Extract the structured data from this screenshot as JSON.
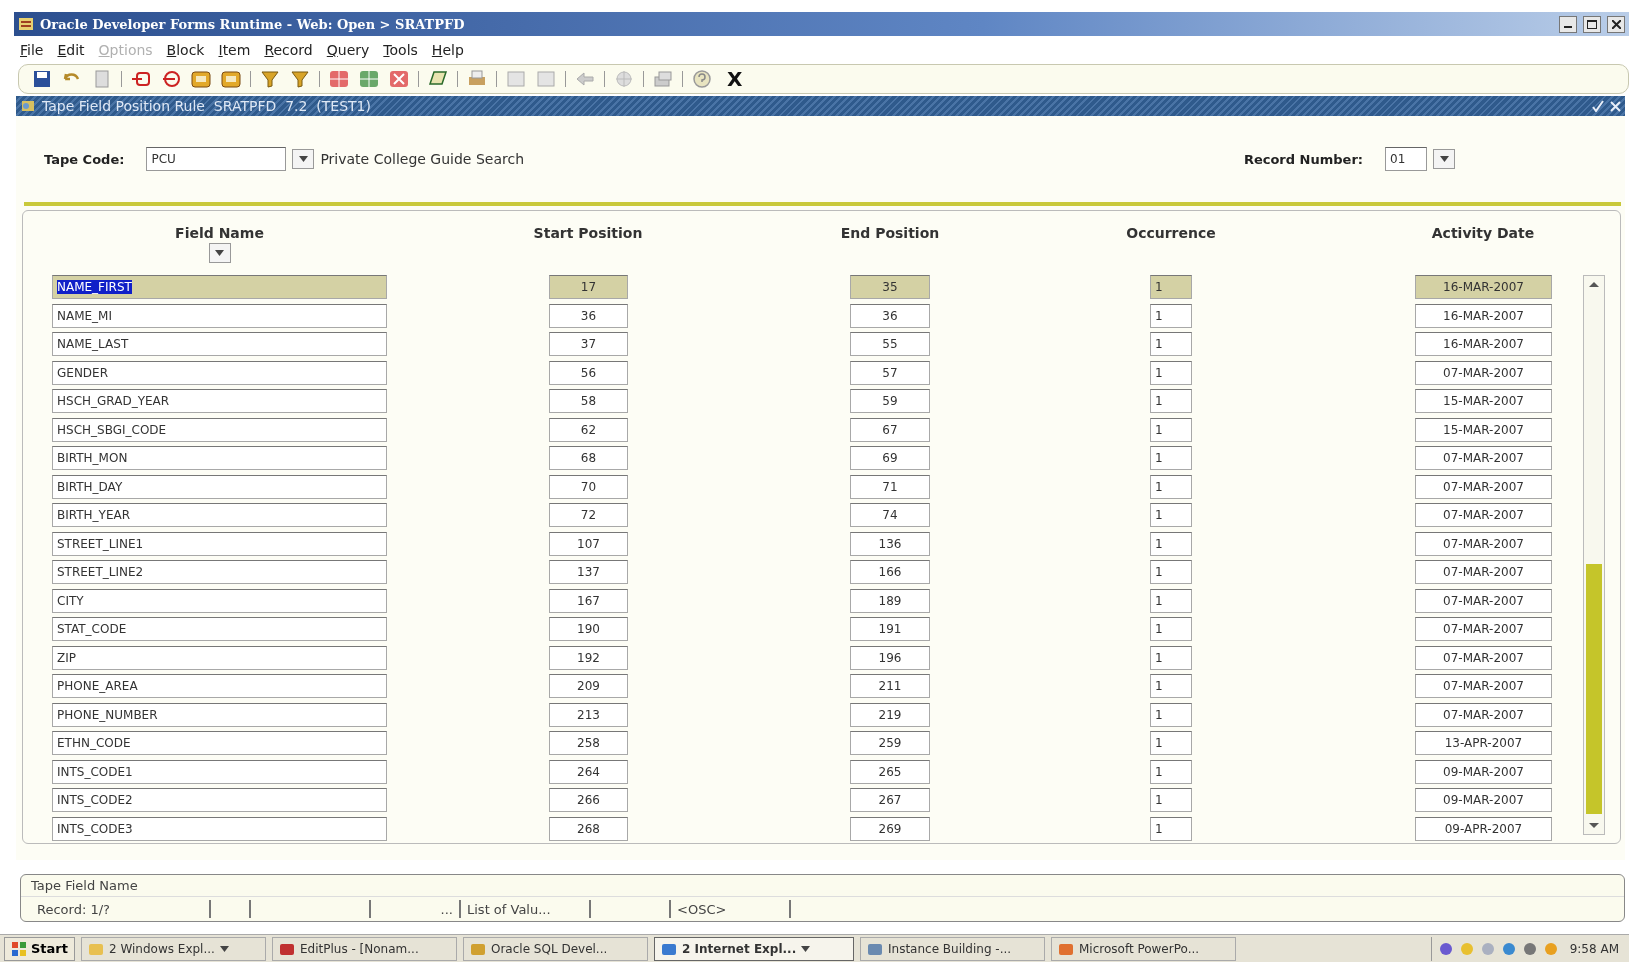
{
  "window": {
    "title": "Oracle Developer Forms Runtime - Web: Open > SRATPFD"
  },
  "menu": [
    {
      "label": "File",
      "disabled": false
    },
    {
      "label": "Edit",
      "disabled": false
    },
    {
      "label": "Options",
      "disabled": true
    },
    {
      "label": "Block",
      "disabled": false
    },
    {
      "label": "Item",
      "disabled": false
    },
    {
      "label": "Record",
      "disabled": false
    },
    {
      "label": "Query",
      "disabled": false
    },
    {
      "label": "Tools",
      "disabled": false
    },
    {
      "label": "Help",
      "disabled": false
    }
  ],
  "toolbar": {
    "exit": "X"
  },
  "form": {
    "title": "Tape Field Position Rule  SRATPFD  7.2  (TEST1)",
    "tape_code": {
      "label": "Tape Code:",
      "value": "PCU",
      "description": "Private College Guide Search"
    },
    "record_number": {
      "label": "Record Number:",
      "value": "01"
    }
  },
  "table": {
    "columns": [
      "Field Name",
      "Start Position",
      "End Position",
      "Occurrence",
      "Activity Date"
    ],
    "rows": [
      {
        "name": "NAME_FIRST",
        "start": "17",
        "end": "35",
        "occurrence": "1",
        "date": "16-MAR-2007",
        "selected": true
      },
      {
        "name": "NAME_MI",
        "start": "36",
        "end": "36",
        "occurrence": "1",
        "date": "16-MAR-2007",
        "selected": false
      },
      {
        "name": "NAME_LAST",
        "start": "37",
        "end": "55",
        "occurrence": "1",
        "date": "16-MAR-2007",
        "selected": false
      },
      {
        "name": "GENDER",
        "start": "56",
        "end": "57",
        "occurrence": "1",
        "date": "07-MAR-2007",
        "selected": false
      },
      {
        "name": "HSCH_GRAD_YEAR",
        "start": "58",
        "end": "59",
        "occurrence": "1",
        "date": "15-MAR-2007",
        "selected": false
      },
      {
        "name": "HSCH_SBGI_CODE",
        "start": "62",
        "end": "67",
        "occurrence": "1",
        "date": "15-MAR-2007",
        "selected": false
      },
      {
        "name": "BIRTH_MON",
        "start": "68",
        "end": "69",
        "occurrence": "1",
        "date": "07-MAR-2007",
        "selected": false
      },
      {
        "name": "BIRTH_DAY",
        "start": "70",
        "end": "71",
        "occurrence": "1",
        "date": "07-MAR-2007",
        "selected": false
      },
      {
        "name": "BIRTH_YEAR",
        "start": "72",
        "end": "74",
        "occurrence": "1",
        "date": "07-MAR-2007",
        "selected": false
      },
      {
        "name": "STREET_LINE1",
        "start": "107",
        "end": "136",
        "occurrence": "1",
        "date": "07-MAR-2007",
        "selected": false
      },
      {
        "name": "STREET_LINE2",
        "start": "137",
        "end": "166",
        "occurrence": "1",
        "date": "07-MAR-2007",
        "selected": false
      },
      {
        "name": "CITY",
        "start": "167",
        "end": "189",
        "occurrence": "1",
        "date": "07-MAR-2007",
        "selected": false
      },
      {
        "name": "STAT_CODE",
        "start": "190",
        "end": "191",
        "occurrence": "1",
        "date": "07-MAR-2007",
        "selected": false
      },
      {
        "name": "ZIP",
        "start": "192",
        "end": "196",
        "occurrence": "1",
        "date": "07-MAR-2007",
        "selected": false
      },
      {
        "name": "PHONE_AREA",
        "start": "209",
        "end": "211",
        "occurrence": "1",
        "date": "07-MAR-2007",
        "selected": false
      },
      {
        "name": "PHONE_NUMBER",
        "start": "213",
        "end": "219",
        "occurrence": "1",
        "date": "07-MAR-2007",
        "selected": false
      },
      {
        "name": "ETHN_CODE",
        "start": "258",
        "end": "259",
        "occurrence": "1",
        "date": "13-APR-2007",
        "selected": false
      },
      {
        "name": "INTS_CODE1",
        "start": "264",
        "end": "265",
        "occurrence": "1",
        "date": "09-MAR-2007",
        "selected": false
      },
      {
        "name": "INTS_CODE2",
        "start": "266",
        "end": "267",
        "occurrence": "1",
        "date": "09-MAR-2007",
        "selected": false
      },
      {
        "name": "INTS_CODE3",
        "start": "268",
        "end": "269",
        "occurrence": "1",
        "date": "09-APR-2007",
        "selected": false
      }
    ]
  },
  "status_bar": {
    "hint": "Tape Field Name",
    "segments": [
      "Record: 1/?",
      "...",
      "List of Valu...",
      "<OSC>"
    ]
  },
  "taskbar": {
    "start": "Start",
    "clock": "9:58 AM",
    "items": [
      {
        "label": "2 Windows Expl...",
        "grouped": true,
        "selected": false
      },
      {
        "label": "EditPlus - [Nonam...",
        "grouped": false,
        "selected": false
      },
      {
        "label": "Oracle SQL Devel...",
        "grouped": false,
        "selected": false
      },
      {
        "label": "2 Internet Expl...",
        "grouped": true,
        "selected": true
      },
      {
        "label": "Instance Building -...",
        "grouped": false,
        "selected": false
      },
      {
        "label": "Microsoft PowerPo...",
        "grouped": false,
        "selected": false
      }
    ]
  }
}
